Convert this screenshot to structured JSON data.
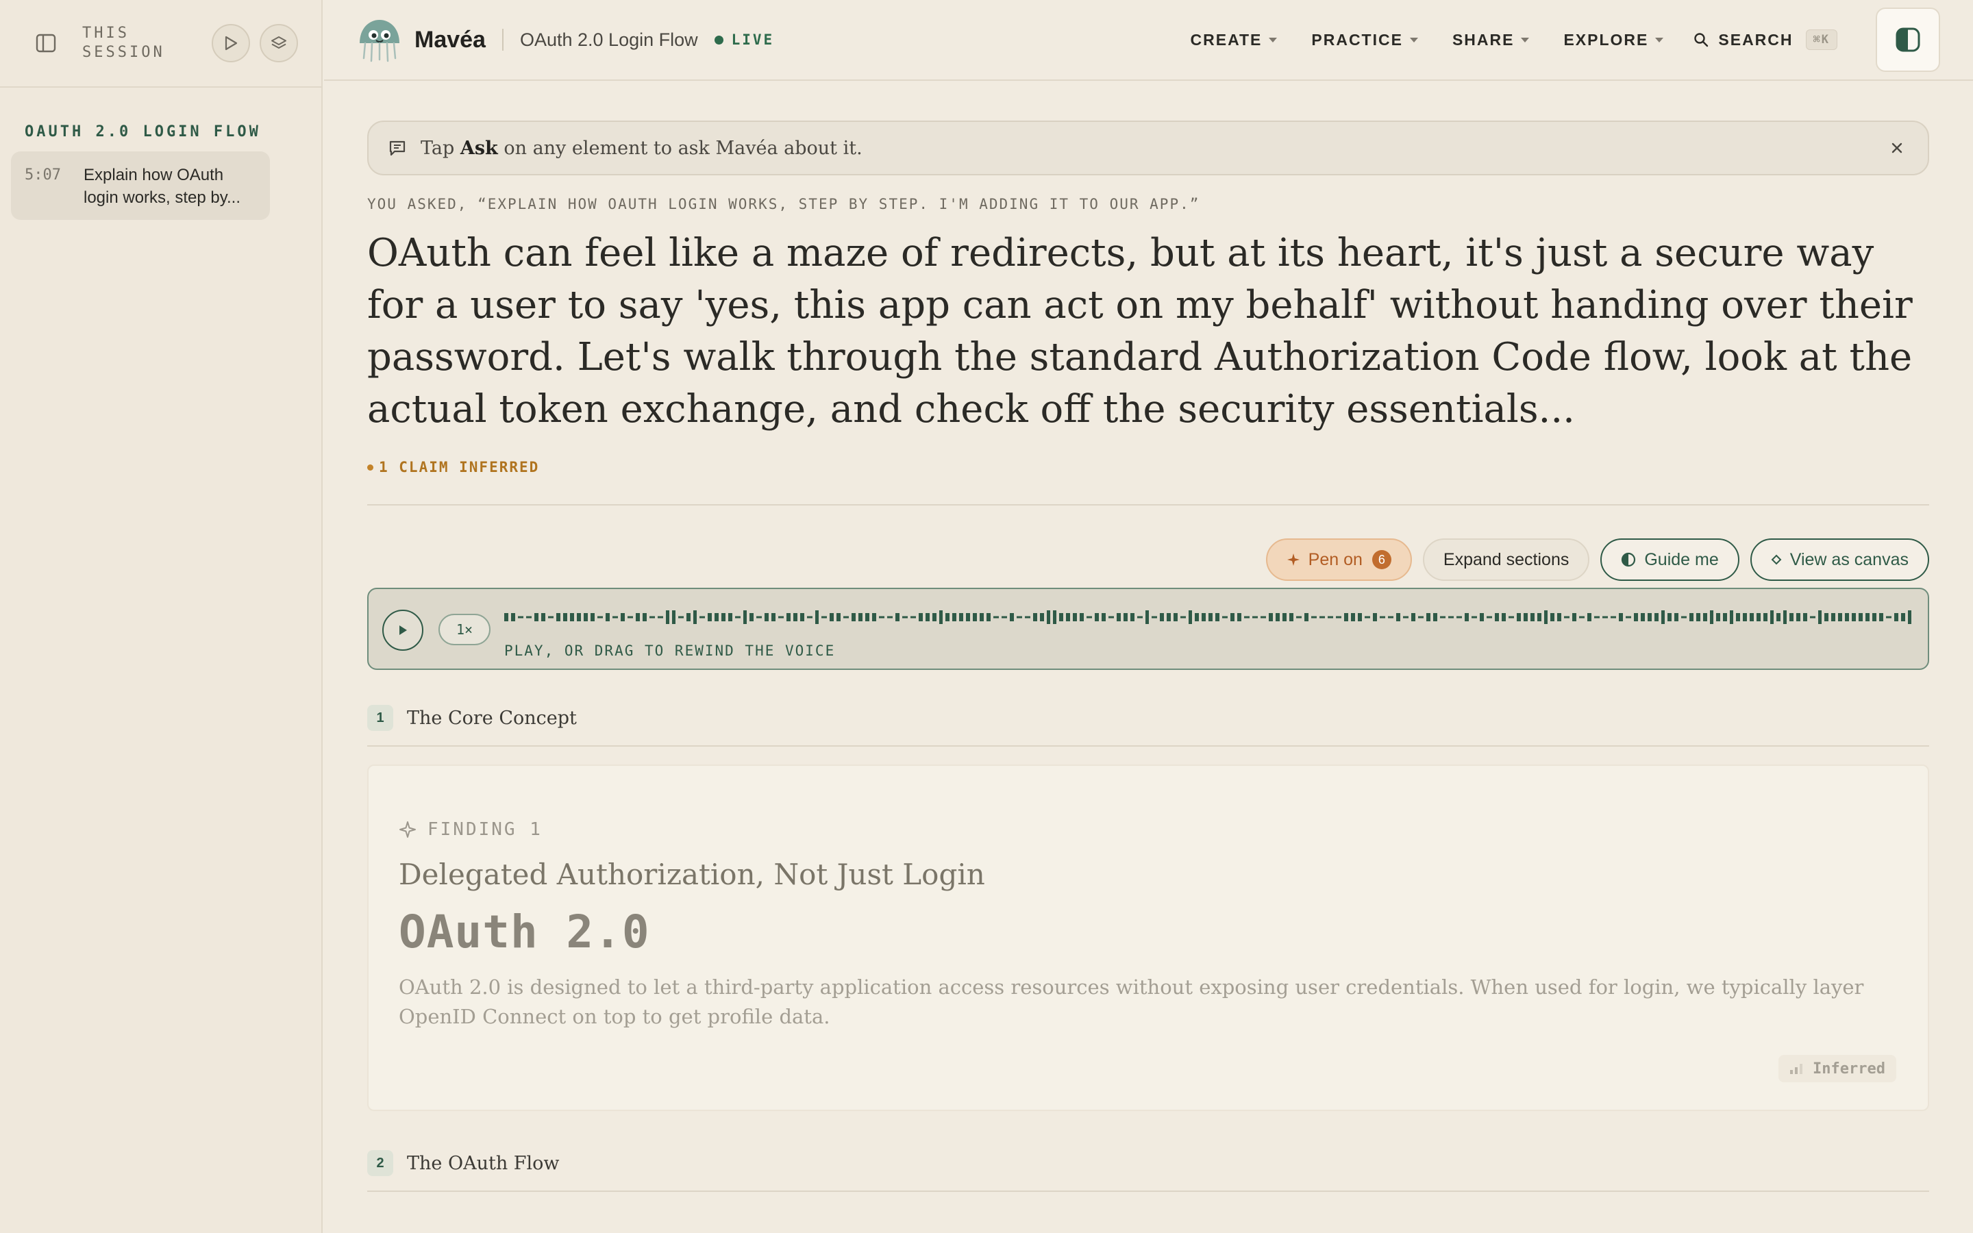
{
  "sidebar": {
    "title": "THIS SESSION",
    "section_label": "OAUTH 2.0 LOGIN FLOW",
    "items": [
      {
        "time": "5:07",
        "text": "Explain how OAuth login works, step by..."
      }
    ]
  },
  "topbar": {
    "brand": "Mavéa",
    "doc_title": "OAuth 2.0 Login Flow",
    "live_label": "LIVE",
    "nav": [
      {
        "label": "CREATE"
      },
      {
        "label": "PRACTICE"
      },
      {
        "label": "SHARE"
      },
      {
        "label": "EXPLORE"
      }
    ],
    "search_label": "SEARCH",
    "search_shortcut": "⌘K"
  },
  "banner": {
    "pre": "Tap",
    "bold": "Ask",
    "post": "on any element to ask Mavéa about it."
  },
  "question": "YOU ASKED, “EXPLAIN HOW OAUTH LOGIN WORKS, STEP BY STEP. I'M ADDING IT TO OUR APP.”",
  "answer": "OAuth can feel like a maze of redirects, but at its heart, it's just a secure way for a user to say 'yes, this app can act on my behalf' without handing over their password. Let's walk through the standard Authorization Code flow, look at the actual token exchange, and check off the security essentials...",
  "claim_label": "1 CLAIM INFERRED",
  "actions": {
    "pen_label": "Pen on",
    "pen_count": "6",
    "expand_label": "Expand sections",
    "guide_label": "Guide me",
    "canvas_label": "View as canvas"
  },
  "player": {
    "speed": "1×",
    "hint": "PLAY, OR DRAG TO REWIND THE VOICE"
  },
  "sections": [
    {
      "num": "1",
      "title": "The Core Concept",
      "finding": {
        "label": "FINDING 1",
        "title": "Delegated Authorization, Not Just Login",
        "big": "OAuth 2.0",
        "desc": "OAuth 2.0 is designed to let a third-party application access resources without exposing user credentials. When used for login, we typically layer OpenID Connect on top to get profile data.",
        "badge": "Inferred"
      }
    },
    {
      "num": "2",
      "title": "The OAuth Flow"
    }
  ],
  "colors": {
    "accent_green": "#2f5a47",
    "pen_orange": "#c16d2f",
    "claim_amber": "#b0741f",
    "background": "#f1ebe0"
  }
}
